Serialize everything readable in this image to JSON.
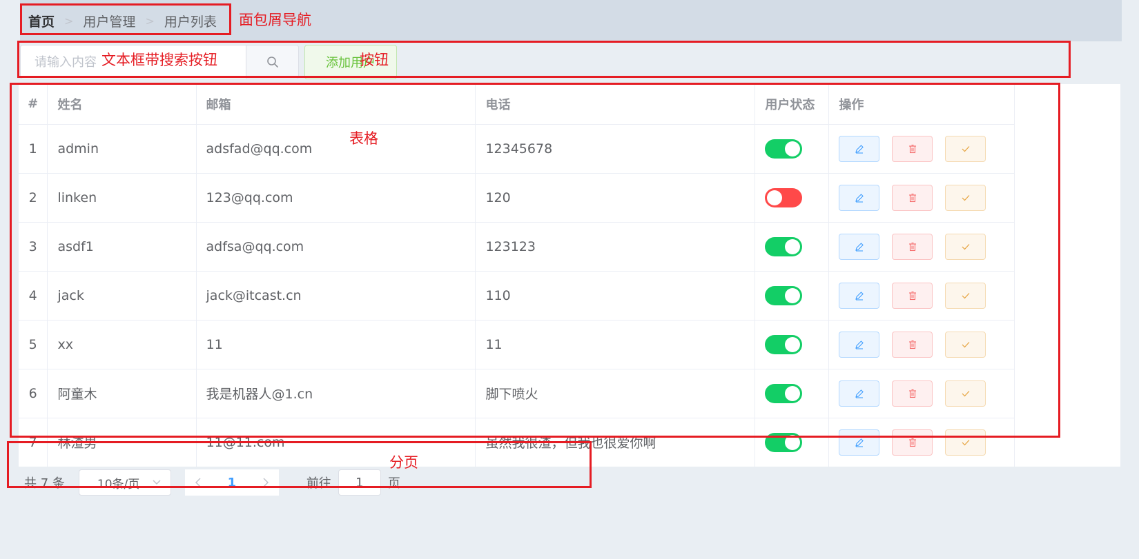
{
  "breadcrumb": {
    "items": [
      "首页",
      "用户管理",
      "用户列表"
    ],
    "separator": ">"
  },
  "search": {
    "placeholder": "请输入内容",
    "value": "",
    "button_icon": "search-icon"
  },
  "add_button": {
    "label": "添加用户"
  },
  "table": {
    "headers": [
      "#",
      "姓名",
      "邮箱",
      "电话",
      "用户状态",
      "操作"
    ],
    "rows": [
      {
        "index": "1",
        "name": "admin",
        "email": "adsfad@qq.com",
        "phone": "12345678",
        "status": true
      },
      {
        "index": "2",
        "name": "linken",
        "email": "123@qq.com",
        "phone": "120",
        "status": false
      },
      {
        "index": "3",
        "name": "asdf1",
        "email": "adfsa@qq.com",
        "phone": "123123",
        "status": true
      },
      {
        "index": "4",
        "name": "jack",
        "email": "jack@itcast.cn",
        "phone": "110",
        "status": true
      },
      {
        "index": "5",
        "name": "xx",
        "email": "11",
        "phone": "11",
        "status": true
      },
      {
        "index": "6",
        "name": "阿童木",
        "email": "我是机器人@1.cn",
        "phone": "脚下喷火",
        "status": true
      },
      {
        "index": "7",
        "name": "林渣男",
        "email": "11@11.com",
        "phone": "虽然我很渣，但我也很爱你啊",
        "status": true
      }
    ],
    "actions": [
      "edit-icon",
      "delete-icon",
      "check-icon"
    ]
  },
  "pagination": {
    "total_text": "共 7 条",
    "page_size": "10条/页",
    "current_page": "1",
    "goto_label": "前往",
    "goto_value": "1",
    "page_suffix": "页"
  },
  "annotations": {
    "breadcrumb": "面包屑导航",
    "search": "文本框带搜索按钮",
    "button": "按钮",
    "table": "表格",
    "pagination": "分页"
  },
  "colors": {
    "switch_on": "#13ce66",
    "switch_off": "#ff4949",
    "primary": "#409eff",
    "success": "#67c23a",
    "danger": "#f56c6c",
    "warning": "#e6a23c",
    "annotation": "#e51c23"
  }
}
